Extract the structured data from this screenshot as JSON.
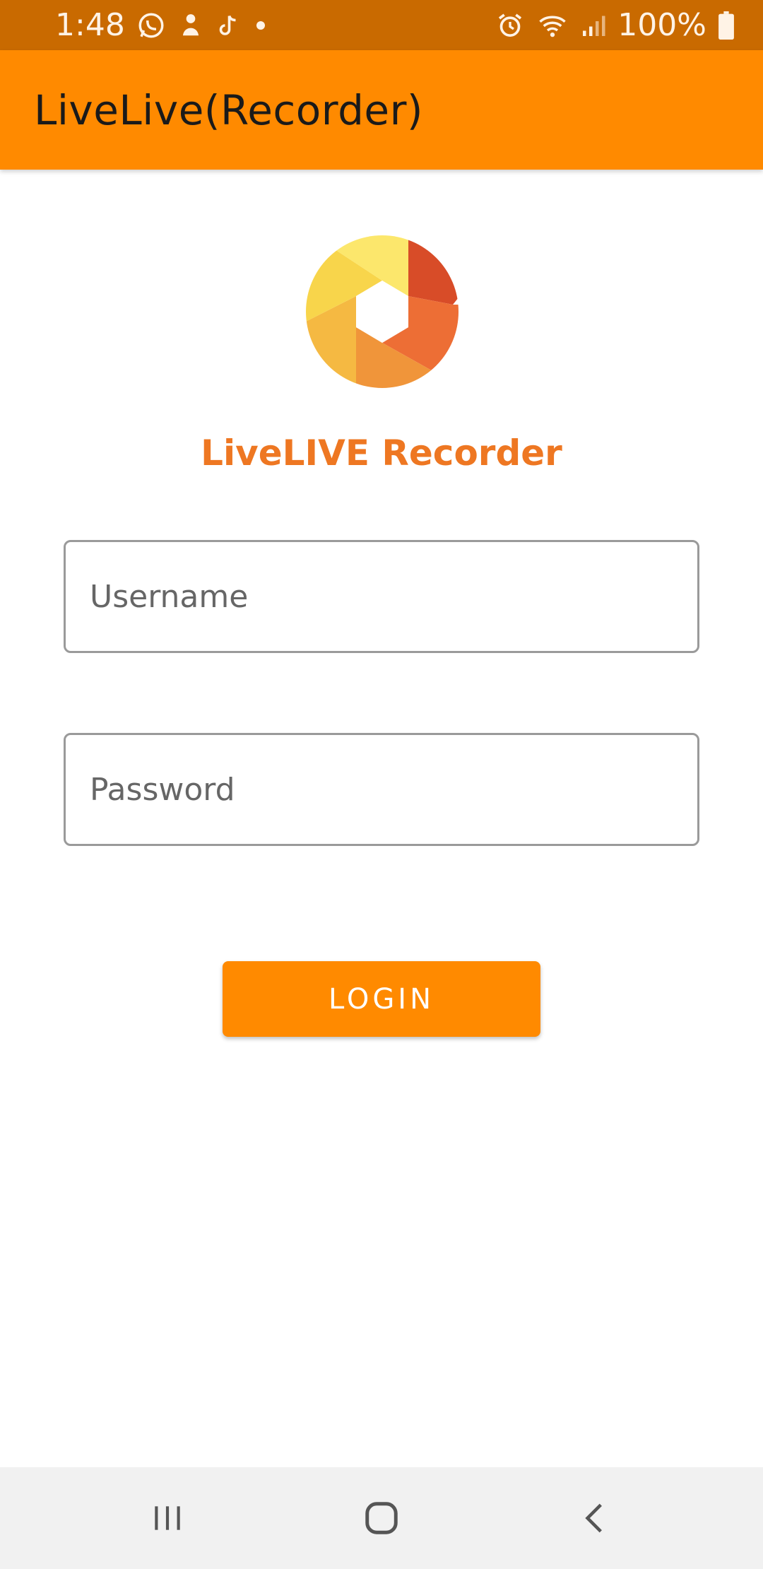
{
  "status_bar": {
    "time": "1:48",
    "battery": "100%",
    "icons_left": [
      "whatsapp-icon",
      "notification-app-icon",
      "tiktok-icon",
      "dot-icon"
    ],
    "icons_right": [
      "alarm-icon",
      "wifi-icon",
      "signal-icon",
      "battery-icon"
    ]
  },
  "app_bar": {
    "title": "LiveLive(Recorder)"
  },
  "brand": {
    "name": "LiveLIVE Recorder",
    "logo_icon": "aperture-logo-icon"
  },
  "form": {
    "username_placeholder": "Username",
    "username_value": "",
    "password_placeholder": "Password",
    "password_value": "",
    "login_label": "LOGIN"
  },
  "nav_bar": {
    "items": [
      "recent-apps-icon",
      "home-icon",
      "back-icon"
    ]
  },
  "colors": {
    "status_bar": "#c96a00",
    "app_bar": "#ff8a00",
    "brand_text": "#ee7722",
    "button": "#ff8a00",
    "nav_bar": "#f1f1f1"
  }
}
